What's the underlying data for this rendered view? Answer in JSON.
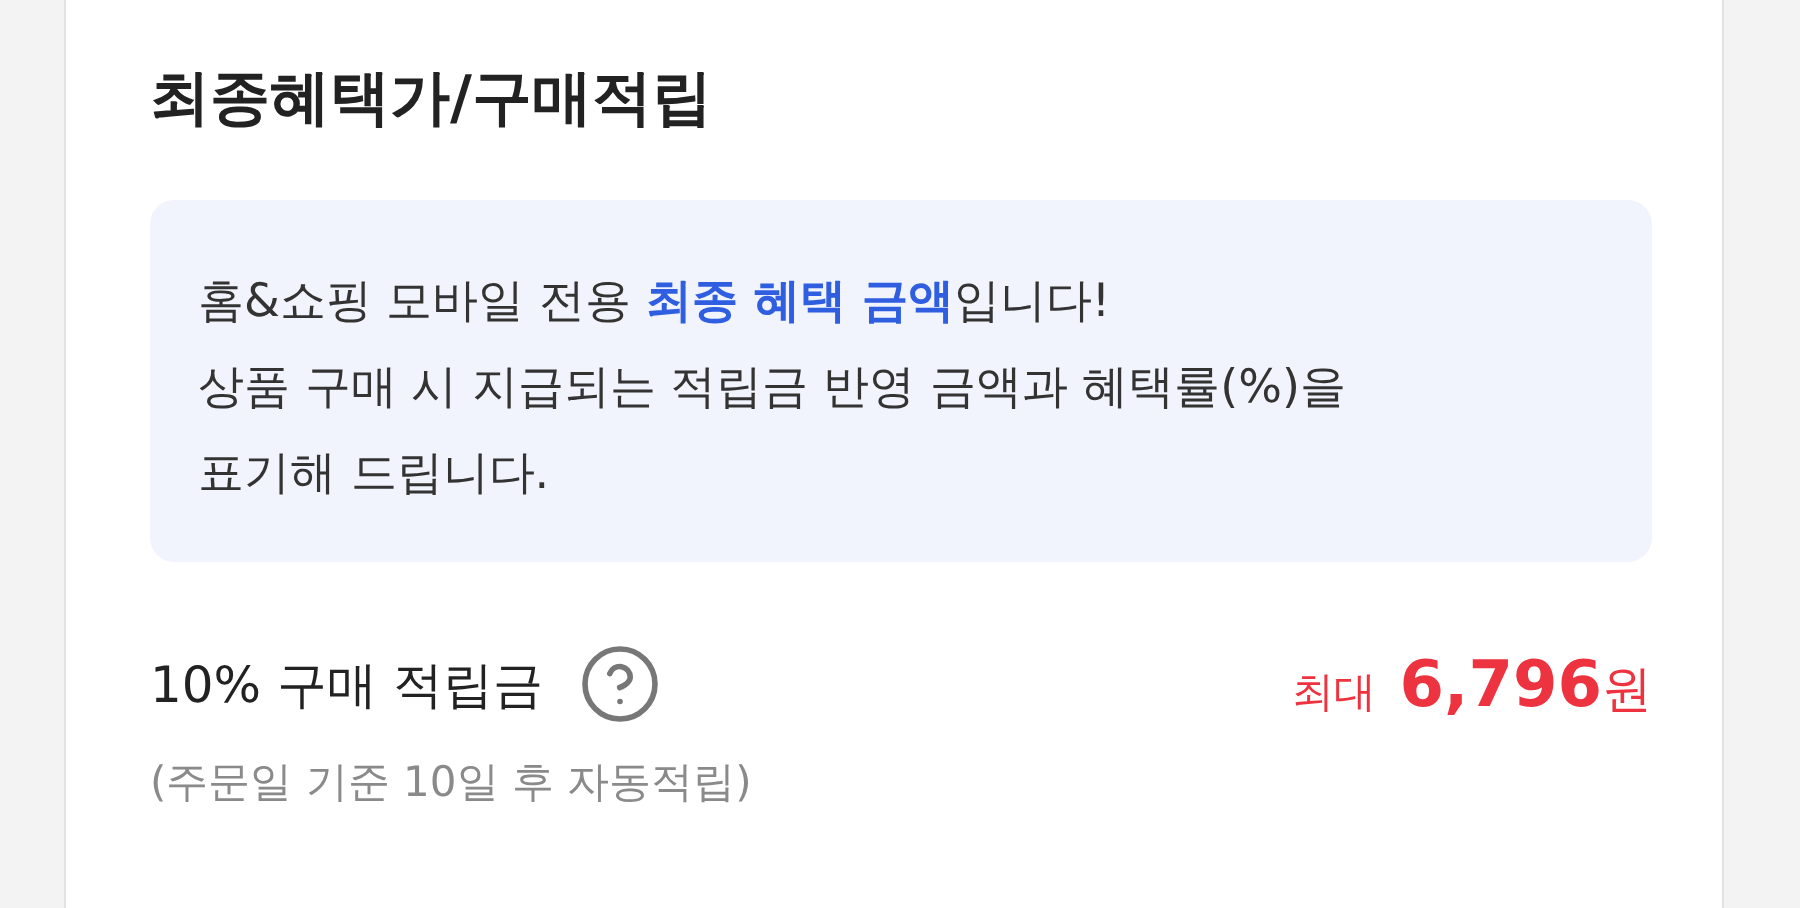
{
  "title": "최종혜택가/구매적립",
  "notice": [
    "홈&쇼핑 모바일 전용 **최종 혜택 금액**입니다!",
    "상품 구매 시 지급되는 적립금 반영 금액과 혜택률(%)을",
    "표기해 드립니다."
  ],
  "reward": {
    "label": "10% 구매 적립금",
    "prefix": "최대",
    "amount": "6,796",
    "unit": "원",
    "note": "(주문일 기준 10일 후 자동적립)"
  }
}
